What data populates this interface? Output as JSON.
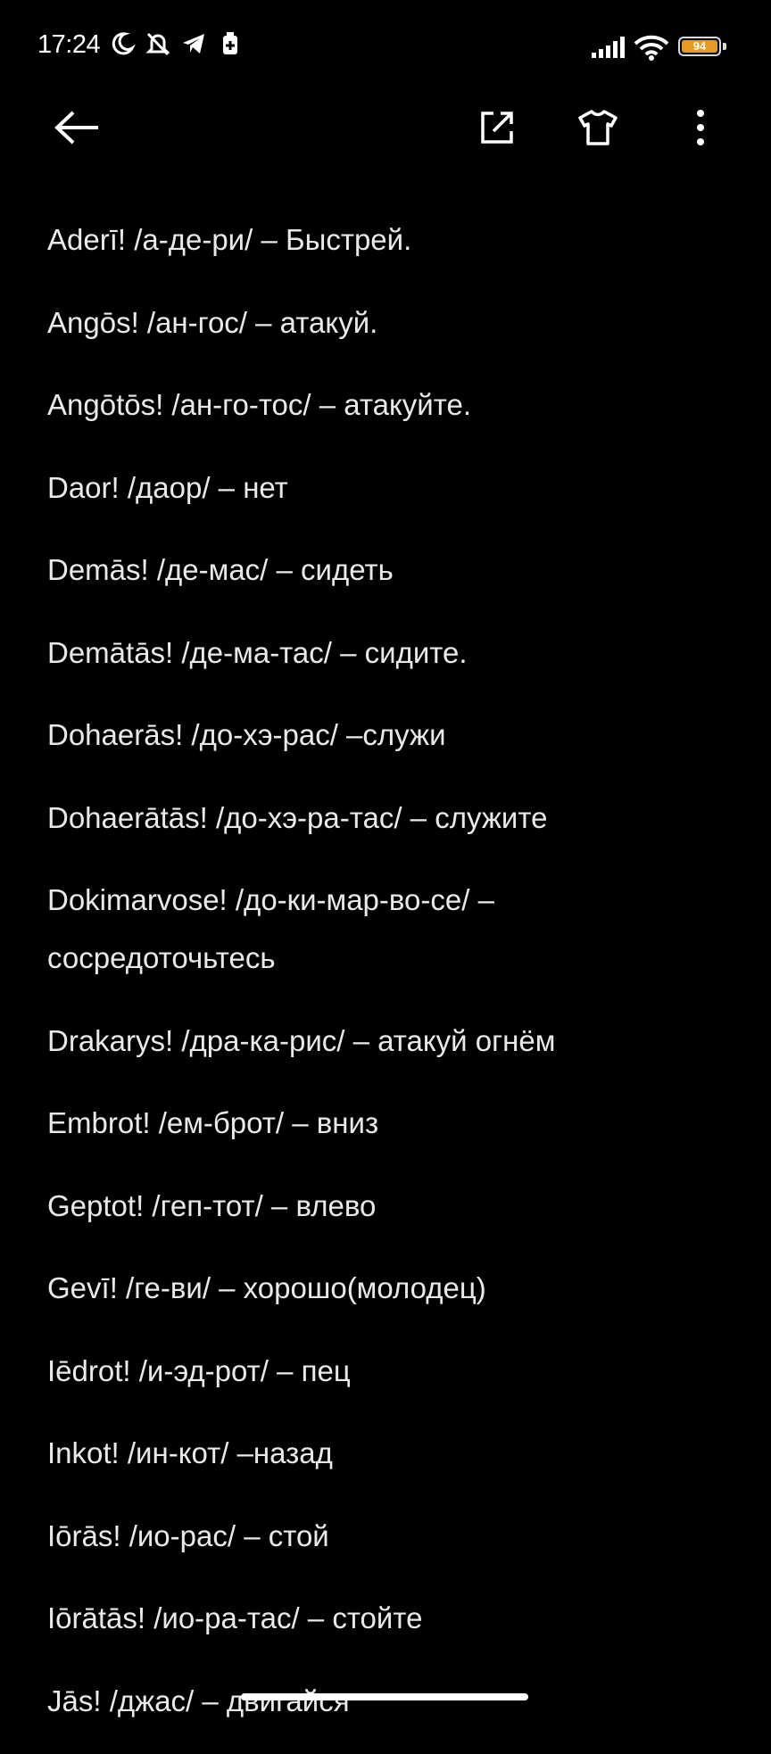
{
  "status_bar": {
    "time": "17:24",
    "battery_level": "94",
    "icons": [
      "moon-icon",
      "bell-off-icon",
      "telegram-icon",
      "battery-saver-icon",
      "signal-icon",
      "wifi-icon",
      "battery-icon"
    ],
    "battery_color": "#e39b21"
  },
  "toolbar": {
    "icons": [
      "back-arrow-icon",
      "share-icon",
      "theme-shirt-icon",
      "more-icon"
    ]
  },
  "entries": [
    "Aderī! /а-де-ри/ – Быстрей.",
    "Angōs! /ан-гос/ – атакуй.",
    "Angōtōs! /ан-го-тос/ – атакуйте.",
    "Daor! /даор/ – нет",
    "Demās! /де-мас/ – сидеть",
    "Demātās! /де-ма-тас/ – сидите.",
    "Dohaerās! /до-хэ-рас/ –служи",
    "Dohaerātās! /до-хэ-ра-тас/ – служите",
    "Dokimarvose! /до-ки-мар-во-се/ – сосредоточьтесь",
    "Drakarys! /дра-ка-рис/ – атакуй огнём",
    "Embrot! /ем-брот/ – вниз",
    "Geptot! /геп-тот/ – влево",
    "Gevī! /ге-ви/ – хорошо(молодец)",
    "Iēdrot! /и-эд-рот/ – пец",
    "Inkot! /ин-кот/ –назад",
    "Iōrās! /ио-рас/ – стой",
    "Iōrātās! /ио-ра-тас/ – стойте",
    "Jās! /джас/ – двигайся"
  ]
}
